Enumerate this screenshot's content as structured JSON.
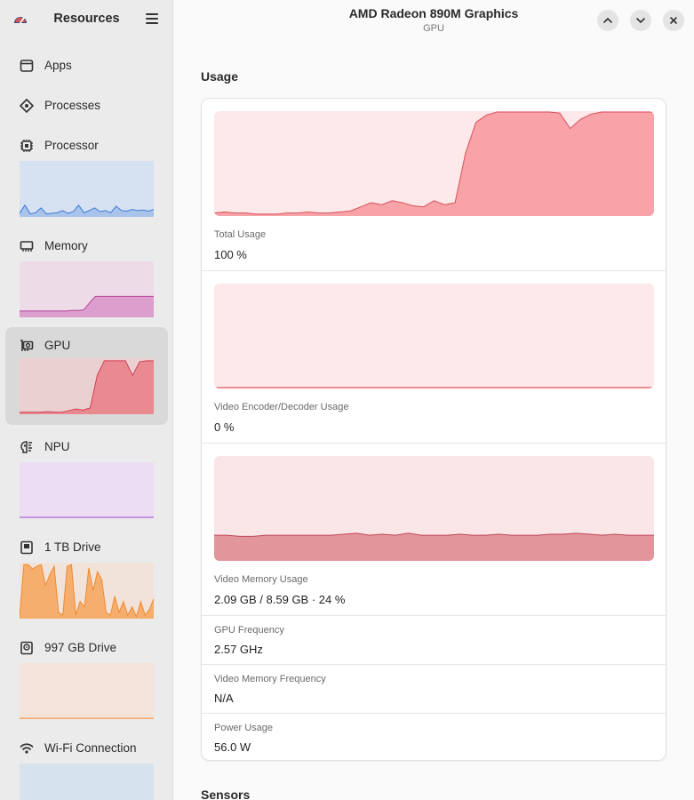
{
  "sidebar": {
    "title": "Resources",
    "app_icon": "gauge-icon",
    "menu_icon": "hamburger-menu-icon",
    "items": [
      {
        "label": "Apps",
        "icon": "window-icon"
      },
      {
        "label": "Processes",
        "icon": "cog-diamond-icon"
      },
      {
        "label": "Processor",
        "icon": "chip-icon"
      },
      {
        "label": "Memory",
        "icon": "memory-icon"
      },
      {
        "label": "GPU",
        "icon": "gpu-icon",
        "active": true
      },
      {
        "label": "NPU",
        "icon": "brain-icon"
      },
      {
        "label": "1 TB Drive",
        "icon": "drive-icon"
      },
      {
        "label": "997 GB Drive",
        "icon": "drive-icon"
      },
      {
        "label": "Wi-Fi Connection",
        "icon": "wifi-icon"
      }
    ]
  },
  "header": {
    "title": "AMD Radeon 890M Graphics",
    "subtitle": "GPU",
    "buttons": [
      "chevron-up-icon",
      "chevron-down-icon",
      "close-icon"
    ]
  },
  "usage": {
    "section_title": "Usage",
    "total": {
      "label": "Total Usage",
      "value": "100 %"
    },
    "video_codec": {
      "label": "Video Encoder/Decoder Usage",
      "value": "0 %"
    },
    "video_memory": {
      "label": "Video Memory Usage",
      "value": "2.09 GB / 8.59 GB · 24 %"
    },
    "gpu_frequency": {
      "label": "GPU Frequency",
      "value": "2.57 GHz"
    },
    "vram_frequency": {
      "label": "Video Memory Frequency",
      "value": "N/A"
    },
    "power": {
      "label": "Power Usage",
      "value": "56.0 W"
    }
  },
  "sensors": {
    "section_title": "Sensors"
  },
  "colors": {
    "accent_red": "#e5707a",
    "gpu_fill": "#f7a3a7",
    "gpu_bg": "#fde9e9",
    "vram_fill": "#e3959c",
    "cpu_blue": "#5a8fdc",
    "mem_pink": "#d07ab8",
    "npu_purple": "#b98ad8",
    "drive_orange": "#f5a05a",
    "wifi_blue": "#a8c4dc"
  },
  "graphs": {
    "total_usage": [
      2,
      3,
      2,
      2,
      1,
      1,
      1,
      2,
      2,
      3,
      2,
      2,
      3,
      4,
      8,
      12,
      10,
      14,
      12,
      9,
      8,
      14,
      10,
      12,
      60,
      90,
      97,
      100,
      100,
      100,
      100,
      100,
      100,
      99,
      84,
      93,
      98,
      100,
      100,
      100,
      100,
      100,
      100
    ],
    "video_codec": [
      0,
      0,
      0,
      0,
      0,
      0,
      0,
      0,
      0,
      0,
      0,
      0,
      0,
      0,
      0,
      0,
      0,
      0,
      0,
      0
    ],
    "video_memory": [
      24,
      24,
      23,
      23,
      24,
      24,
      24,
      24,
      24,
      24,
      25,
      26,
      24,
      25,
      24,
      26,
      24,
      24,
      24,
      25,
      24,
      24,
      25,
      24,
      24,
      24,
      25,
      25,
      26,
      25,
      24,
      25,
      24,
      24,
      24
    ],
    "processor": [
      5,
      20,
      4,
      6,
      15,
      4,
      5,
      6,
      10,
      5,
      8,
      20,
      6,
      10,
      15,
      8,
      10,
      6,
      18,
      10,
      9,
      12,
      10,
      11,
      9,
      12
    ],
    "memory": [
      10,
      10,
      10,
      10,
      10,
      10,
      10,
      10,
      10,
      11,
      11,
      12,
      25,
      37,
      37,
      37,
      37,
      37,
      37,
      37,
      37,
      37,
      37,
      37
    ],
    "gpu": [
      2,
      2,
      2,
      2,
      3,
      2,
      2,
      5,
      8,
      6,
      10,
      70,
      97,
      97,
      97,
      97,
      70,
      95,
      97,
      97
    ],
    "npu": [
      0,
      0,
      0,
      0,
      0,
      0,
      0,
      0,
      0
    ],
    "drive1": [
      0,
      98,
      98,
      90,
      95,
      98,
      60,
      80,
      95,
      10,
      5,
      95,
      98,
      5,
      30,
      20,
      92,
      50,
      85,
      70,
      10,
      5,
      40,
      10,
      30,
      5,
      20,
      2,
      30,
      5,
      15,
      35
    ],
    "drive2": [
      0,
      0,
      0,
      0,
      0,
      0,
      0,
      0,
      0
    ]
  }
}
